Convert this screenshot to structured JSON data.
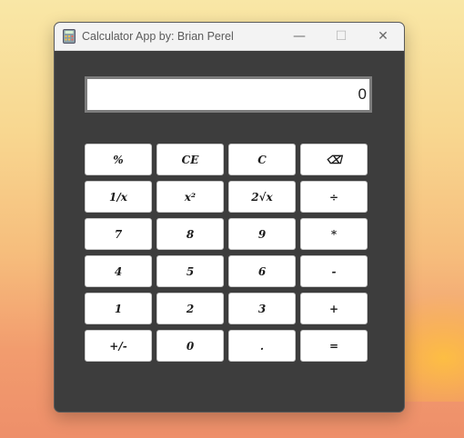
{
  "window": {
    "title": "Calculator App by: Brian Perel",
    "icon": "calculator-icon",
    "controls": {
      "minimize": "—",
      "maximize": "☐",
      "close": "✕"
    }
  },
  "display": {
    "value": "0"
  },
  "keys": [
    [
      "%",
      "CE",
      "C",
      "⌫"
    ],
    [
      "1/x",
      "x²",
      "2√x",
      "÷"
    ],
    [
      "7",
      "8",
      "9",
      "*"
    ],
    [
      "4",
      "5",
      "6",
      "-"
    ],
    [
      "1",
      "2",
      "3",
      "+"
    ],
    [
      "+/-",
      "0",
      ".",
      "="
    ]
  ]
}
